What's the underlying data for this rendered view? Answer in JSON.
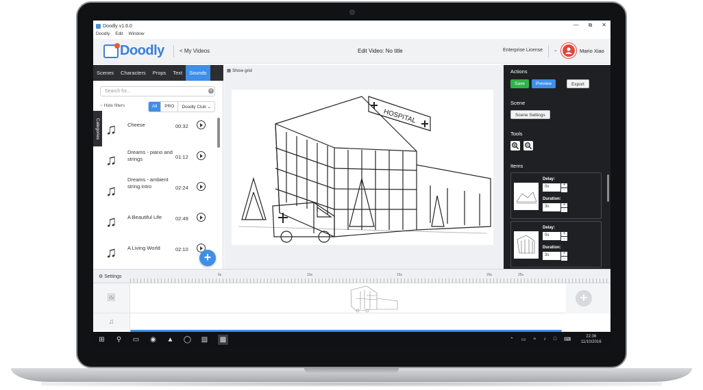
{
  "window": {
    "title": "Doodly v1.6.0",
    "menu": [
      "Doodly",
      "Edit",
      "Window"
    ],
    "controls": [
      "—",
      "⧉",
      "✕"
    ]
  },
  "header": {
    "logo_text": "Doodly",
    "back_link": "< My Videos",
    "edit_title": "Edit Video: No title",
    "license": "Enterprise License",
    "user_name": "Mario Xiao"
  },
  "tabs": [
    {
      "label": "Scenes"
    },
    {
      "label": "Characters"
    },
    {
      "label": "Props"
    },
    {
      "label": "Text"
    },
    {
      "label": "Sounds",
      "active": true
    }
  ],
  "sounds_panel": {
    "search_placeholder": "Search for...",
    "hide_filters": "~ Hide filters",
    "filters": [
      {
        "label": "All",
        "active": true
      },
      {
        "label": "PRO"
      },
      {
        "label": "Doodly Club ⌄"
      }
    ],
    "categories_label": "Categories",
    "items": [
      {
        "name": "Cheese",
        "duration": "00:32"
      },
      {
        "name": "Dreams - piano and strings",
        "duration": "01:12"
      },
      {
        "name": "Dreams - ambient string intro",
        "duration": "02:24"
      },
      {
        "name": "A Beautiful Life",
        "duration": "02:49"
      },
      {
        "name": "A Living World",
        "duration": "02:10"
      }
    ]
  },
  "canvas": {
    "show_grid": "Show grid",
    "sign_text": "HOSPITAL"
  },
  "right_panel": {
    "actions_label": "Actions",
    "save": "Save",
    "preview": "Preview",
    "export": "Export",
    "scene_label": "Scene",
    "scene_settings": "Scene Settings",
    "tools_label": "Tools",
    "items_label": "Items",
    "items": [
      {
        "delay_label": "Delay:",
        "delay": "0s",
        "duration_label": "Duration:",
        "duration": "3s"
      },
      {
        "delay_label": "Delay:",
        "delay": "0s",
        "duration_label": "Duration:",
        "duration": "3s"
      }
    ]
  },
  "timeline": {
    "settings": "Settings",
    "ticks": [
      "5s",
      "10s",
      "15s",
      "20s",
      "25s"
    ]
  },
  "taskbar": {
    "time": "22:36",
    "date": "11/10/2016"
  },
  "colors": {
    "accent": "#3f8ee8",
    "save": "#2fb34a",
    "avatar": "#e2463a",
    "dark_panel": "#1f2023"
  }
}
